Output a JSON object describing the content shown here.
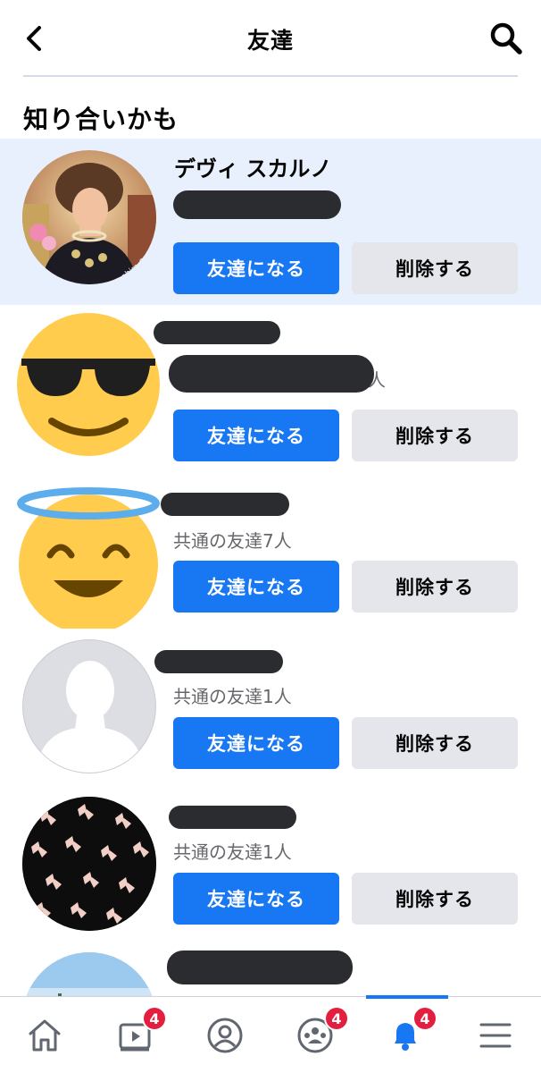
{
  "header": {
    "title": "友達",
    "back_icon": "chevron-left-icon",
    "search_icon": "search-icon"
  },
  "section": {
    "title": "知り合いかも"
  },
  "suggestions": [
    {
      "name": "デヴィ スカルノ",
      "mutual": "",
      "add_label": "友達になる",
      "remove_label": "削除する",
      "highlighted": true,
      "watermark": "Masahiro Okamura"
    },
    {
      "name": "",
      "mutual": "人",
      "add_label": "友達になる",
      "remove_label": "削除する"
    },
    {
      "name": "",
      "mutual": "共通の友達7人",
      "add_label": "友達になる",
      "remove_label": "削除する"
    },
    {
      "name": "",
      "mutual": "共通の友達1人",
      "add_label": "友達になる",
      "remove_label": "削除する"
    },
    {
      "name": "",
      "mutual": "共通の友達1人",
      "add_label": "友達になる",
      "remove_label": "削除する"
    }
  ],
  "bottom_nav": {
    "items": [
      {
        "icon": "home-icon"
      },
      {
        "icon": "video-icon",
        "badge": "4"
      },
      {
        "icon": "profile-icon"
      },
      {
        "icon": "groups-icon",
        "badge": "4"
      },
      {
        "icon": "bell-icon",
        "badge": "4",
        "active": true
      },
      {
        "icon": "menu-icon"
      }
    ]
  },
  "colors": {
    "accent": "#1877f2",
    "highlight_bg": "#e7f0fc",
    "secondary_button": "#e4e6eb",
    "badge": "#e41e3f",
    "redaction": "#2b2c30"
  }
}
